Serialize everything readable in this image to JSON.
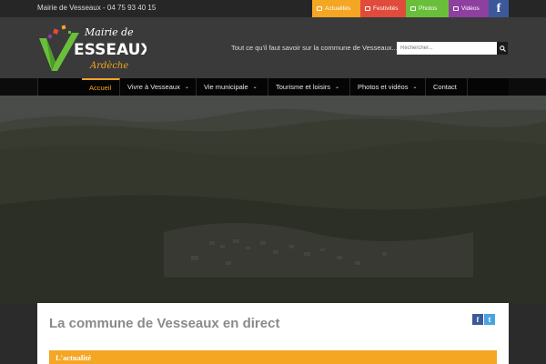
{
  "topbar": {
    "contact": "Mairie de Vesseaux - 04 75 93 40 15",
    "quick_links": [
      {
        "label": "Actualités",
        "color": "#f5a623",
        "icon": "news-icon"
      },
      {
        "label": "Festivités",
        "color": "#e14b3b",
        "icon": "calendar-icon"
      },
      {
        "label": "Photos",
        "color": "#6abf3a",
        "icon": "image-icon"
      },
      {
        "label": "Vidéos",
        "color": "#8e3fa0",
        "icon": "video-icon"
      }
    ],
    "facebook": {
      "label": "f",
      "color": "#3b5998"
    }
  },
  "header": {
    "logo": {
      "line1": "Mairie de",
      "line2": "ESSEAUX",
      "line3": "Ardèche",
      "initial": "V"
    },
    "tagline": "Tout ce qu'il faut savoir sur la commune de Vesseaux...",
    "search": {
      "placeholder": "Rechercher...",
      "icon": "search-icon"
    }
  },
  "nav": {
    "items": [
      {
        "label": "Accueil",
        "active": true,
        "dropdown": false
      },
      {
        "label": "Vivre à Vesseaux",
        "active": false,
        "dropdown": true
      },
      {
        "label": "Vie municipale",
        "active": false,
        "dropdown": true
      },
      {
        "label": "Tourisme et loisirs",
        "active": false,
        "dropdown": true
      },
      {
        "label": "Photos et vidéos",
        "active": false,
        "dropdown": true
      },
      {
        "label": "Contact",
        "active": false,
        "dropdown": false
      }
    ],
    "chevron": "⌄",
    "accent": "#f5a623"
  },
  "main": {
    "title": "La commune de Vesseaux en direct",
    "share": {
      "facebook": "f",
      "twitter": "t"
    },
    "section": "L'actualité"
  }
}
